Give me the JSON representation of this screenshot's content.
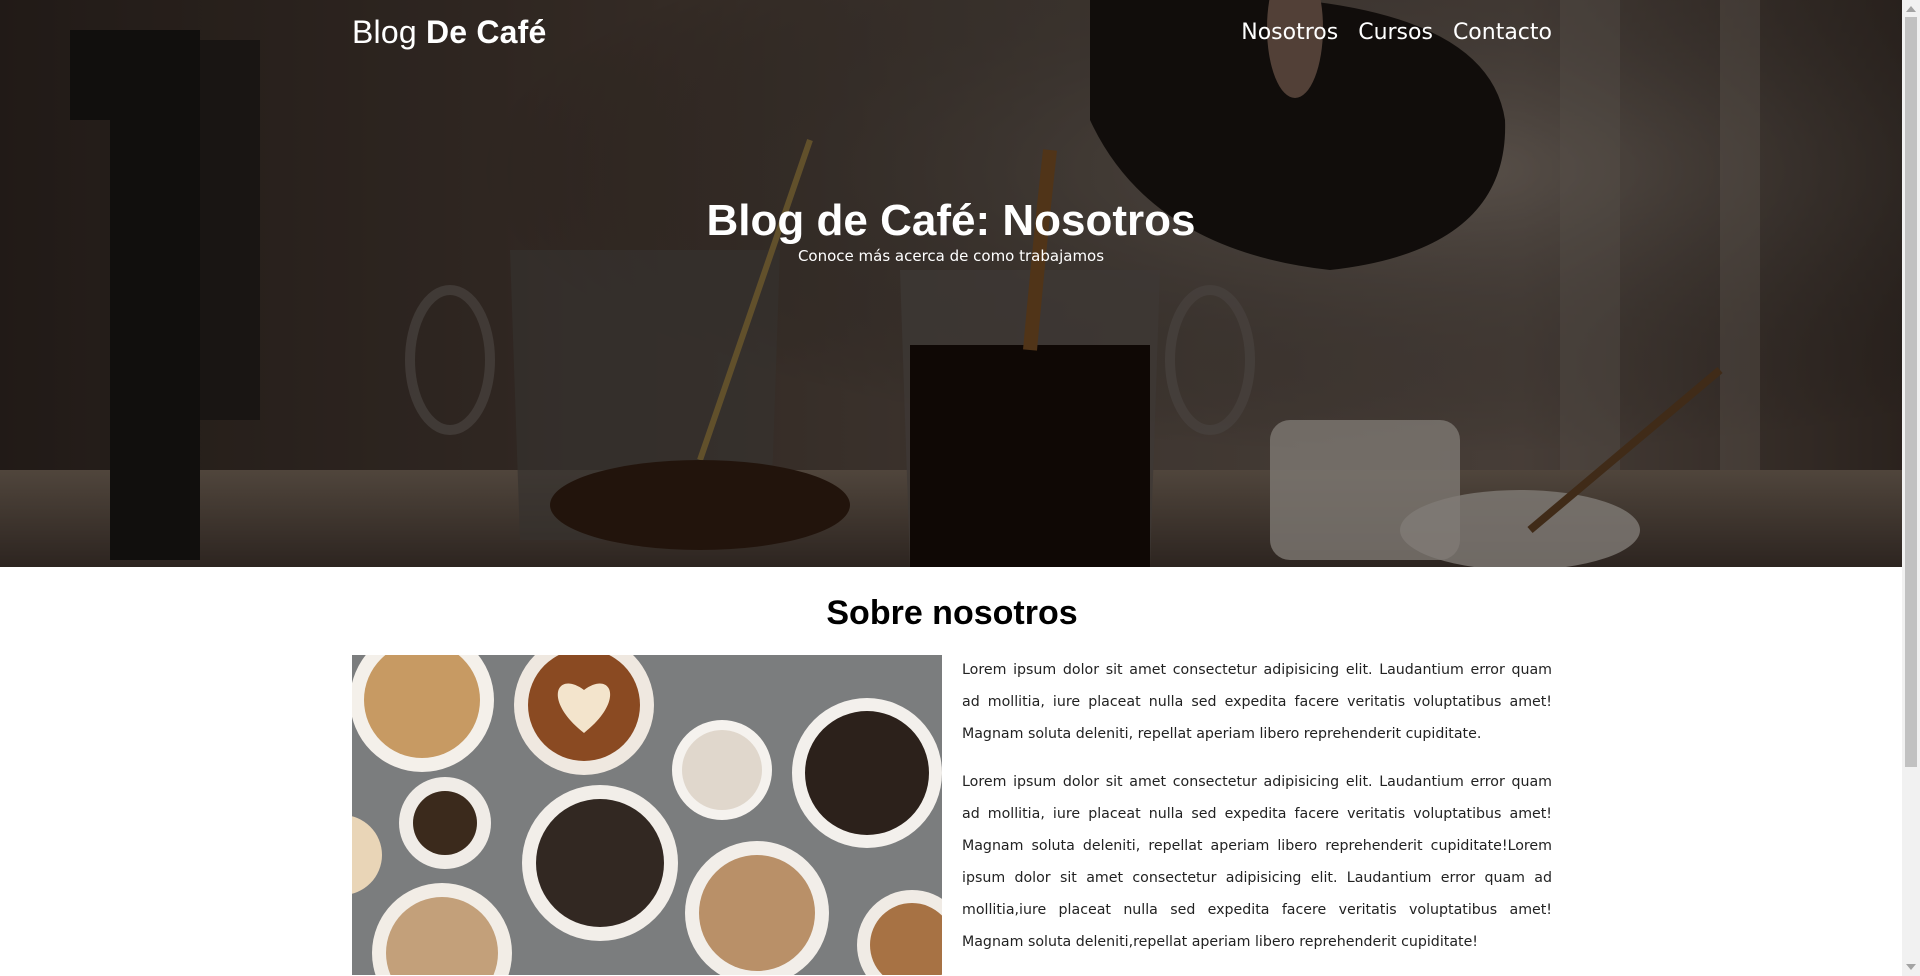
{
  "header": {
    "logo_regular": "Blog ",
    "logo_bold": "De Café",
    "nav": [
      "Nosotros",
      "Cursos",
      "Contacto"
    ]
  },
  "hero": {
    "title": "Blog de Café: Nosotros",
    "subtitle": "Conoce más acerca de como trabajamos"
  },
  "about": {
    "title": "Sobre nosotros",
    "paragraphs": [
      "Lorem ipsum dolor sit amet consectetur adipisicing elit. Laudantium error quam ad mollitia, iure placeat nulla sed expedita facere veritatis voluptatibus amet! Magnam soluta deleniti, repellat aperiam libero reprehenderit cupiditate.",
      "Lorem ipsum dolor sit amet consectetur adipisicing elit. Laudantium error quam ad mollitia, iure placeat nulla sed expedita facere veritatis voluptatibus amet! Magnam soluta deleniti, repellat aperiam libero reprehenderit cupiditate!Lorem ipsum dolor sit amet consectetur adipisicing elit. Laudantium error quam ad mollitia,iure placeat nulla sed expedita facere veritatis voluptatibus amet! Magnam soluta deleniti,repellat aperiam libero reprehenderit cupiditate!"
    ]
  },
  "colors": {
    "text_light": "#ffffff",
    "body_text": "#222222",
    "heading": "#000000",
    "hero_overlay": "#000000"
  },
  "icons": {
    "hero_image": "coffee-pouring-photo",
    "about_image": "coffee-cups-topdown-photo"
  }
}
